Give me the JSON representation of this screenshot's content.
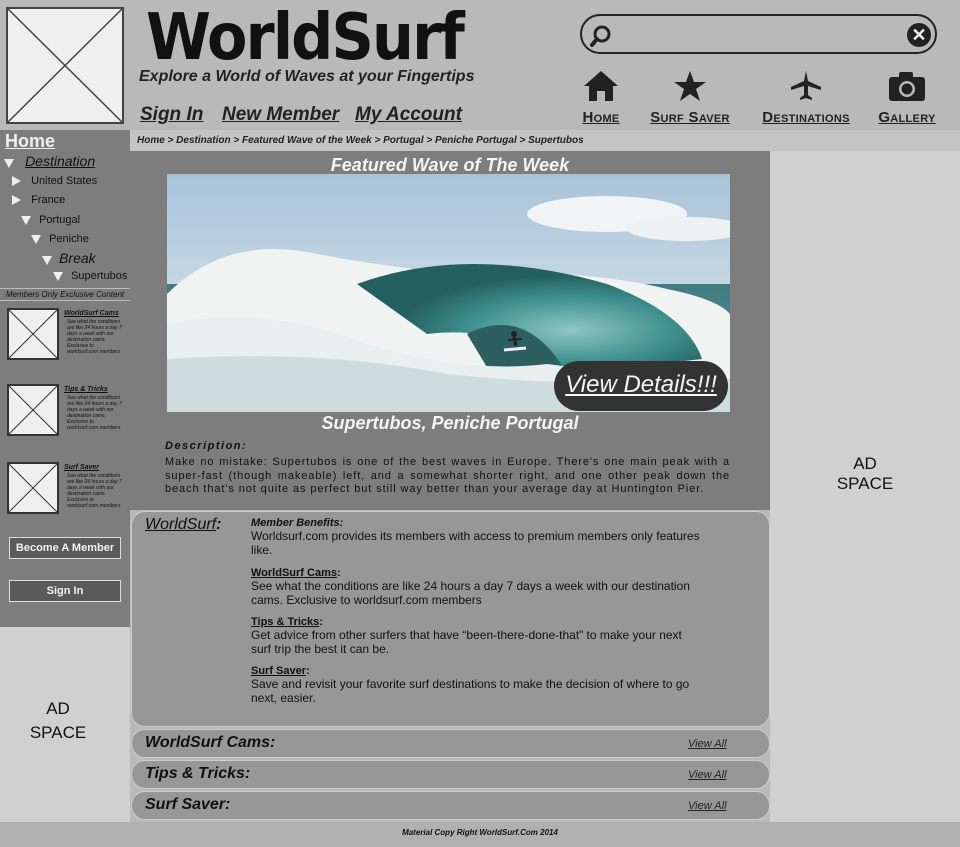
{
  "header": {
    "site_title": "WorldSurf",
    "tagline": "Explore a World of Waves at your Fingertips",
    "links": [
      "Sign In",
      "New Member",
      "My Account"
    ],
    "search": {
      "value": "",
      "placeholder": ""
    },
    "nav": [
      {
        "label": "Home",
        "icon": "home-icon"
      },
      {
        "label": "Surf Saver",
        "icon": "star-icon"
      },
      {
        "label": "Destinations",
        "icon": "airplane-icon"
      },
      {
        "label": "Gallery",
        "icon": "camera-icon"
      }
    ]
  },
  "breadcrumb": "Home > Destination > Featured Wave of the Week > Portugal > Peniche Portugal > Supertubos",
  "sidebar": {
    "home": "Home",
    "destination": "Destination",
    "tree": [
      "United States",
      "France",
      "Portugal",
      "Peniche",
      "Break",
      "Supertubos"
    ],
    "members_only": "Members Only Exclusive Content",
    "mini_items": [
      {
        "title": "WorldSurf Cams",
        "desc": "See what the conditions are like 24 hours a day 7 days a week with our destination cams. Exclusive to worldsurf.com members"
      },
      {
        "title": "Tips & Tricks",
        "desc": "See what the conditions are like 24 hours a day 7 days a week with our destination cams. Exclusive to worldsurf.com members"
      },
      {
        "title": "Surf Saver",
        "desc": "See what the conditions are like 24 hours a day 7 days a week with our destination cams. Exclusive to worldsurf.com members"
      }
    ],
    "become_member": "Become A Member",
    "sign_in": "Sign In"
  },
  "ads": {
    "left": [
      "AD",
      "SPACE"
    ],
    "right": [
      "AD",
      "SPACE"
    ]
  },
  "featured": {
    "title": "Featured Wave of The Week",
    "view_details": "View Details!!!",
    "caption": "Supertubos, Peniche Portugal",
    "description_label": "Description:",
    "description": "Make no mistake: Supertubos is one of the best waves in Europe. There's one main peak with a super-fast (though makeable) left, and a somewhat shorter right, and one other peak down the beach that's not quite as perfect but still way better than your average day at Huntington Pier."
  },
  "benefits": {
    "heading": "WorldSurf",
    "heading_colon": ":",
    "items": [
      {
        "title": "Member Benefits:",
        "text": "Worldsurf.com provides its members with access to premium members only features like."
      },
      {
        "title": "WorldSurf Cams",
        "text": "See what the conditions are like 24 hours a day 7 days a week with our destination cams. Exclusive to worldsurf.com members"
      },
      {
        "title": "Tips & Tricks",
        "text": "Get advice from other surfers that have “been-there-done-that” to make your next surf trip the best it can be."
      },
      {
        "title": "Surf Saver",
        "text": "Save and revisit your favorite surf destinations to make the decision of where to go next, easier."
      }
    ]
  },
  "sections": [
    {
      "title": "WorldSurf Cams:",
      "link": "View All"
    },
    {
      "title": "Tips & Tricks:",
      "link": "View All"
    },
    {
      "title": "Surf Saver:",
      "link": "View All"
    }
  ],
  "footer": "Material Copy Right WorldSurf.Com 2014",
  "colors": {
    "sidebar": "#7d7d7d",
    "page": "#b9b9b9",
    "ad": "#d0d0d0"
  }
}
